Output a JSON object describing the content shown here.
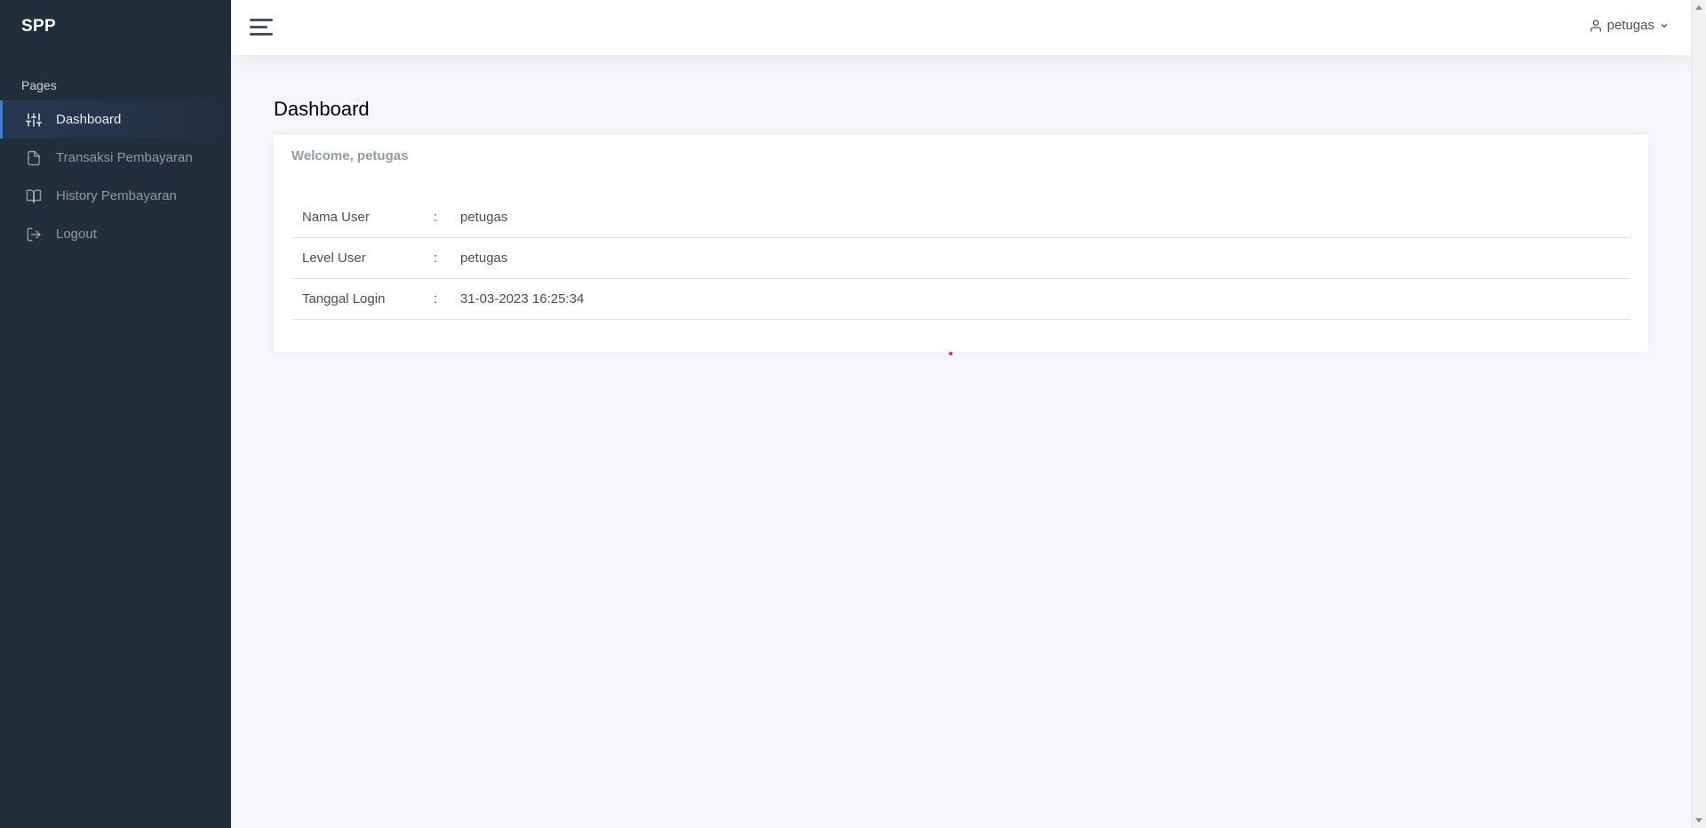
{
  "sidebar": {
    "brand": "SPP",
    "header": "Pages",
    "items": [
      {
        "label": "Dashboard",
        "icon": "sliders-icon",
        "active": true
      },
      {
        "label": "Transaksi Pembayaran",
        "icon": "file-icon",
        "active": false
      },
      {
        "label": "History Pembayaran",
        "icon": "book-open-icon",
        "active": false
      },
      {
        "label": "Logout",
        "icon": "log-out-icon",
        "active": false
      }
    ]
  },
  "topbar": {
    "menu_icon": "hamburger-icon",
    "user_name": "petugas",
    "user_icon": "user-icon",
    "dropdown_icon": "chevron-down-icon"
  },
  "main": {
    "title": "Dashboard",
    "card": {
      "title": "Welcome, petugas",
      "rows": [
        {
          "key": "Nama User",
          "sep": ":",
          "value": "petugas"
        },
        {
          "key": "Level User",
          "sep": ":",
          "value": "petugas"
        },
        {
          "key": "Tanggal Login",
          "sep": ":",
          "value": "31-03-2023 16:25:34"
        }
      ]
    }
  },
  "colors": {
    "sidebar_bg": "#222e3c",
    "accent": "#3b7ddd",
    "page_bg": "#f5f7fb"
  }
}
